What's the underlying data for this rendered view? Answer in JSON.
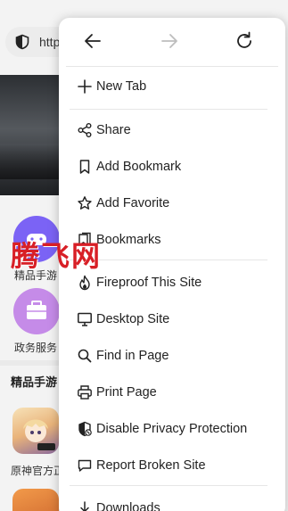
{
  "background": {
    "url_text": "http",
    "apps": [
      {
        "label": "精品手游",
        "color": "#7b63f5"
      },
      {
        "label": "政务服务",
        "color": "#c58be8"
      }
    ],
    "section_title": "精品手游",
    "games": [
      {
        "label": "原神官方正"
      }
    ],
    "watermark": "腾飞网"
  },
  "menu": {
    "nav": [
      {
        "name": "back",
        "icon": "arrow-left-icon",
        "enabled": true
      },
      {
        "name": "forward",
        "icon": "arrow-right-icon",
        "enabled": false
      },
      {
        "name": "reload",
        "icon": "reload-icon",
        "enabled": true
      }
    ],
    "items": [
      {
        "label": "New Tab",
        "icon": "plus-icon"
      },
      {
        "label": "Share",
        "icon": "share-icon"
      },
      {
        "label": "Add Bookmark",
        "icon": "bookmark-icon"
      },
      {
        "label": "Add Favorite",
        "icon": "star-icon"
      },
      {
        "label": "Bookmarks",
        "icon": "bookmarks-icon"
      },
      {
        "label": "Fireproof This Site",
        "icon": "fire-icon"
      },
      {
        "label": "Desktop Site",
        "icon": "monitor-icon"
      },
      {
        "label": "Find in Page",
        "icon": "search-icon"
      },
      {
        "label": "Print Page",
        "icon": "printer-icon"
      },
      {
        "label": "Disable Privacy Protection",
        "icon": "shield-off-icon"
      },
      {
        "label": "Report Broken Site",
        "icon": "chat-bubble-icon"
      },
      {
        "label": "Downloads",
        "icon": "download-icon"
      }
    ]
  }
}
